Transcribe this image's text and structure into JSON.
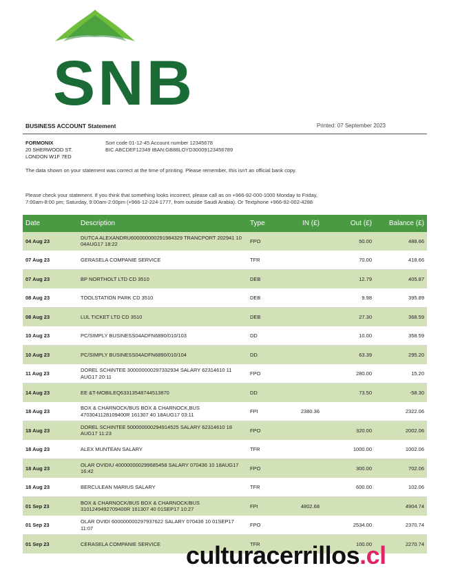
{
  "logo": {
    "text": "SNB",
    "color_dark": "#1a6b35",
    "color_light": "#6fbf3c"
  },
  "header": {
    "title": "BUSINESS ACCOUNT Statement",
    "printed": "Printed: 07 September 2023"
  },
  "customer": {
    "company": "FORMONIX",
    "address1": "20 SHERWOOD ST.",
    "address2": "LONDON W1F 7ED"
  },
  "bank": {
    "line1": "Sort code 01-12-45   Account number 12345678",
    "line2": "BIC  ABCDEF12349   IBAN:GB88LOYD30009123456789"
  },
  "notes": {
    "correct": "The data shown on your statement was correct at the time of printing. Please remember, this isn't an official bank copy.",
    "check": "Please check your statement. If you think that something looks incorrect, please call as on +966-92-000-1000 Monday to Friday, 7:00am-8:00 pm; Saturday, 9:00am-2:00pm (+966-12-224-1777, from outside Saudi Arabia). Or Textphone +966-92-002-4288"
  },
  "table": {
    "headers": [
      "Date",
      "Description",
      "Type",
      "IN (£)",
      "Out (£)",
      "Balance (£)"
    ],
    "rows": [
      {
        "date": "04 Aug 23",
        "desc": "DUTCA ALEXANDRU600000000291984329 TRANCPORT 202941 10 04AUG17 18:22",
        "type": "FPO",
        "in": "",
        "out": "50.00",
        "bal": "488.66"
      },
      {
        "date": "07 Aug 23",
        "desc": "GERASELA COMPANIE SERVICE",
        "type": "TFR",
        "in": "",
        "out": "70.00",
        "bal": "418.66"
      },
      {
        "date": "07 Aug 23",
        "desc": "BP NORTHOLT LTD CD 3510",
        "type": "DEB",
        "in": "",
        "out": "12.79",
        "bal": "405.87"
      },
      {
        "date": "08 Aug 23",
        "desc": "TOOLSTATION PARK CD 3510",
        "type": "DEB",
        "in": "",
        "out": "9.98",
        "bal": "395.89"
      },
      {
        "date": "08 Aug 23",
        "desc": "LUL TICKET LTD CD 3510",
        "type": "DEB",
        "in": "",
        "out": "27.30",
        "bal": "368.59"
      },
      {
        "date": "10 Aug 23",
        "desc": "PC/SIMPLY BUSINESS04ADFN6890/010/103",
        "type": "DD",
        "in": "",
        "out": "10.00",
        "bal": "358.59"
      },
      {
        "date": "10 Aug 23",
        "desc": "PC/SIMPLY BUSINESS04ADFN6890/010/104",
        "type": "DD",
        "in": "",
        "out": "63.39",
        "bal": "295.20"
      },
      {
        "date": "11 Aug 23",
        "desc": "DOREL SCHINTEE 300000000297332934 SALARY 62314610 11 AUG17 20:11",
        "type": "FPO",
        "in": "",
        "out": "280.00",
        "bal": "15.20"
      },
      {
        "date": "14 Aug 23",
        "desc": "EE &T-MOBILEQ63313548744513870",
        "type": "DD",
        "in": "",
        "out": "73.50",
        "bal": "-58.30"
      },
      {
        "date": "18 Aug 23",
        "desc": "BOX & CHARNOCK/BUS BOX & CHARNOCK,BUS 4703041128109400R 161307 40 18AUG17 03:11",
        "type": "FPI",
        "in": "2380.36",
        "out": "",
        "bal": "2322.06"
      },
      {
        "date": "18 Aug 23",
        "desc": "DOREL SCHINTEE 500000000294914525 SALARY 62314610 18 AUG17 11:23",
        "type": "FPO",
        "in": "",
        "out": "320.00",
        "bal": "2002.06"
      },
      {
        "date": "18 Aug 23",
        "desc": "ALEX MUNTEAN SALARY",
        "type": "TFR",
        "in": "",
        "out": "1000.00",
        "bal": "1002.06"
      },
      {
        "date": "18 Aug 23",
        "desc": "OLAR OVIDIU 400000000299685458 SALARY 070436 10 18AUG17 16:42",
        "type": "FPO",
        "in": "",
        "out": "300.00",
        "bal": "702.06"
      },
      {
        "date": "18 Aug 23",
        "desc": "BERCULEAN MARIUS SALARY",
        "type": "TFR",
        "in": "",
        "out": "600.00",
        "bal": "102.06"
      },
      {
        "date": "01 Sep 23",
        "desc": "BOX & CHARNOCK/BUS BOX & CHARNOCK/BUS 3101249492709400R 161307 40 01SEP17 10:27",
        "type": "FPI",
        "in": "4802.68",
        "out": "",
        "bal": "4904.74"
      },
      {
        "date": "01 Sep 23",
        "desc": "OLAR OVIDI 600000000297937622 SALARY 070436 10 01SEP17 11:07",
        "type": "FPO",
        "in": "",
        "out": "2534.00",
        "bal": "2370.74"
      },
      {
        "date": "01 Sep 23",
        "desc": "CERASELA COMPANIE SERVICE",
        "type": "TFR",
        "in": "",
        "out": "100.00",
        "bal": "2270.74"
      }
    ]
  },
  "watermark": {
    "main": "culturacerrillos",
    "dot": ".",
    "tld": "cl"
  }
}
